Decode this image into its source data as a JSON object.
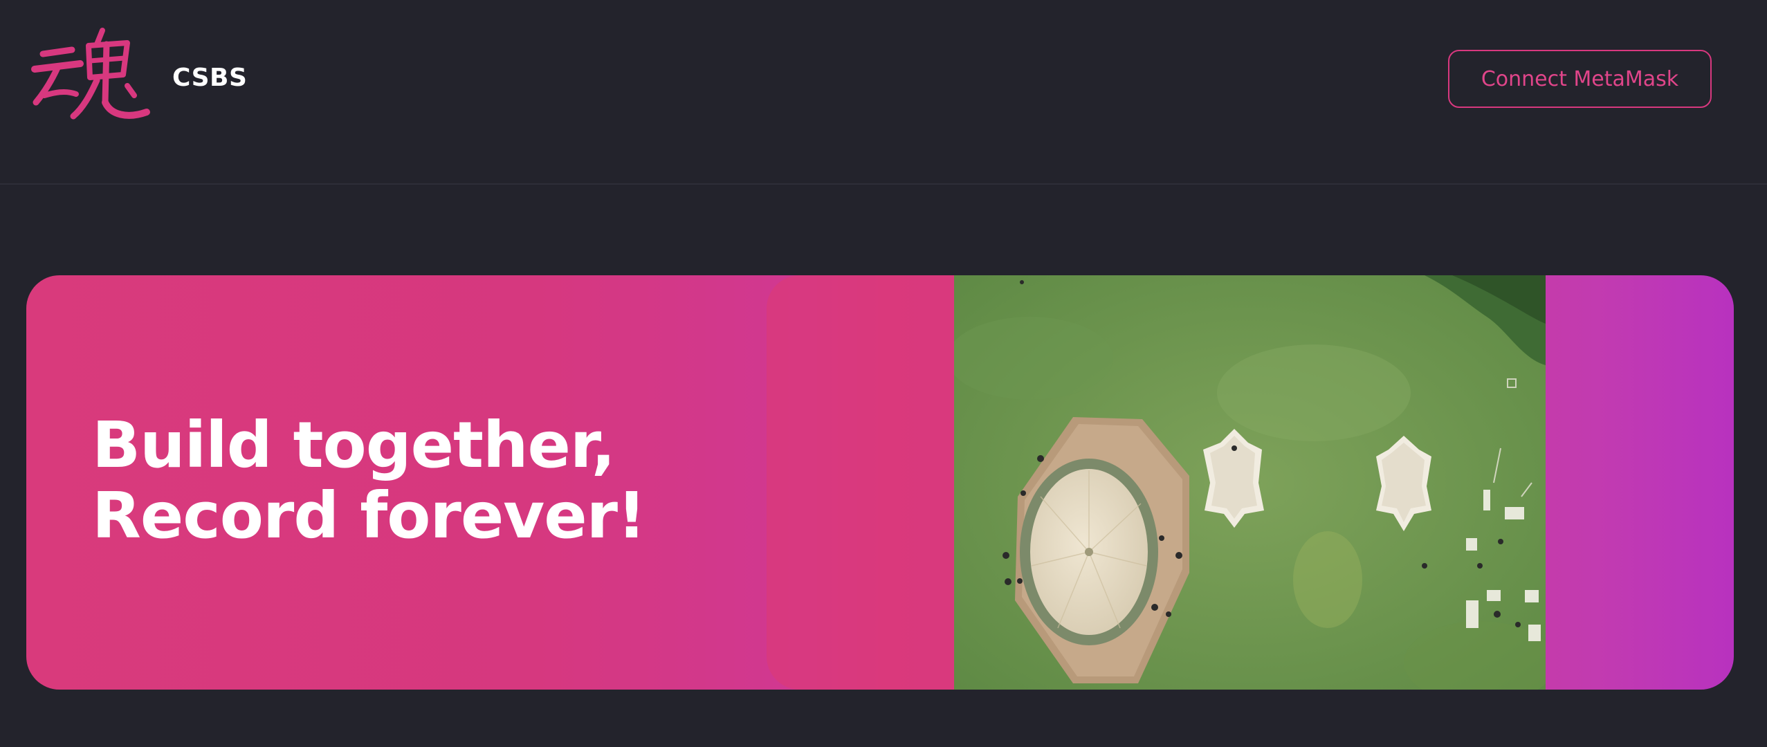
{
  "header": {
    "logo": {
      "icon": "calligraphy-logo-icon",
      "glyph": "魂",
      "color": "#d8387f"
    },
    "brand_name": "CSBS",
    "connect_button_label": "Connect MetaMask"
  },
  "hero": {
    "title_line1": "Build together,",
    "title_line2": "Record forever!",
    "image": {
      "icon": "aerial-tents-photo"
    }
  },
  "colors": {
    "background": "#23232c",
    "accent": "#d8387f",
    "hero_gradient_start": "#d93a7c",
    "hero_gradient_end": "#b832bf"
  }
}
